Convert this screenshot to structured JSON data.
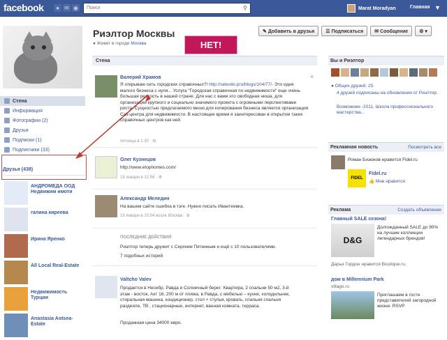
{
  "topbar": {
    "logo": "facebook",
    "search_placeholder": "Поиск",
    "user": "Marat Moradyan",
    "home": "Главная"
  },
  "profile": {
    "name": "Риэлтор Москвы",
    "lives_prefix": "Живет в городе",
    "lives_city": "Москва"
  },
  "callout": "НЕТ!",
  "actions": {
    "add_friend": "Добавить в друзья",
    "subscribe": "Подписаться",
    "message": "Сообщение",
    "gear": "⚙ ▾"
  },
  "leftnav": [
    {
      "label": "Стена"
    },
    {
      "label": "Информация"
    },
    {
      "label": "Фотографии (2)"
    },
    {
      "label": "Друзья"
    },
    {
      "label": "Подписки (1)"
    },
    {
      "label": "Подписчики (33)"
    }
  ],
  "friends_header": "Друзья (438)",
  "friends": [
    {
      "name": "АНДРОМЕДА ООД Недвижим имоти"
    },
    {
      "name": "галина киреева"
    },
    {
      "name": "Ирина Яренко"
    },
    {
      "name": "All Local Real-Estate"
    },
    {
      "name": "Недвижимость Турции"
    },
    {
      "name": "Anastasia Aotsea-Estate"
    }
  ],
  "wall": {
    "header": "Стена",
    "posts": [
      {
        "author": "Валерий Храмов",
        "text_a": "Я открываю сеть городских справочных?!",
        "link": "http://seteviki.pro/blogs/104/77/-",
        "text_b": "Это идея малого бизнеса с нуля... Услуга \"Городская справочная по недвижимости\" еще очень большая редкость в нашей стране. Для нас с вами это свободная ниша, для организации крупного и социально значимого проекта с огромными перспективами роста. Сущностью предлагаемого мною для копирования бизнеса является организация Call-центра для недвижимости. В настоящее время я заинтересован в открытии таких справочных центров как ней",
        "meta": "пятница в 1:30 · ⚙"
      },
      {
        "author": "Олег Кузнецов",
        "link": "http://www.etophomes.com/",
        "meta": "18 января в 12:56 · ⚙"
      },
      {
        "author": "Александр Меледин",
        "text": "На вашем сайте ошибка в тэге. Нужно писать Ивантеевка.",
        "meta": "18 января в 10:04 возле Москва · ⚙"
      }
    ],
    "recent_label": "ПОСЛЕДНИЕ ДЕЙСТВИЯ",
    "recent_text": "Риэлтор теперь дружит с Сергеем Пятниным и ещё с 10 пользователями.",
    "recent_more": "7 подобных историй",
    "last_post": {
      "author": "Valtcho Valev",
      "text": "Продается в Несебр, Равда и Солнечный берег: Квартира, 2 спальни 50 м2, 3-й этаж - восток, Акт 16, 200 м от пляжа, в Равда, с мебелью – кухня, холодильник, стиральная машина, кондиционер, стол + стулья, кровать, спальня спальня раздеяле, ТВ , стационарные, интернет, ванная комната, терраса.",
      "price": "Продажная цена 34000 евро."
    }
  },
  "right": {
    "you_realtor": "Вы и Риэлтор",
    "mutual": "Общих друзей: 25",
    "mutual_sub": "4 друзей подписаны на обновления от Риэлтор.",
    "school": "Возможние -2011, Школа профессионального мастерства...",
    "ads_news_header": "Рекламная новость",
    "ads_news_link": "Посмотреть все",
    "ads_news_text": "Роман Бизюков нравится Fidel.ru",
    "fidel_name": "Fidel.ru",
    "fidel_like": "Мне нравится",
    "fidel_logo": "FIDEL",
    "ads_header": "Реклама",
    "ads_link": "Создать объявление",
    "ad1_title": "Главный SALE сезона!",
    "ad1_text": "Долгожданный SALE до 90% на лучшие коллекции легендарных брендов!",
    "ad1_footer": "Дарья Гордон нравится Boutique.ru.",
    "ad1_logo": "D&G",
    "ad2_title": "дом в Millennium Park",
    "ad2_sub": "villago.ru",
    "ad2_text": "Приглашаем в гости представителей загородной жизни. RSVP"
  }
}
